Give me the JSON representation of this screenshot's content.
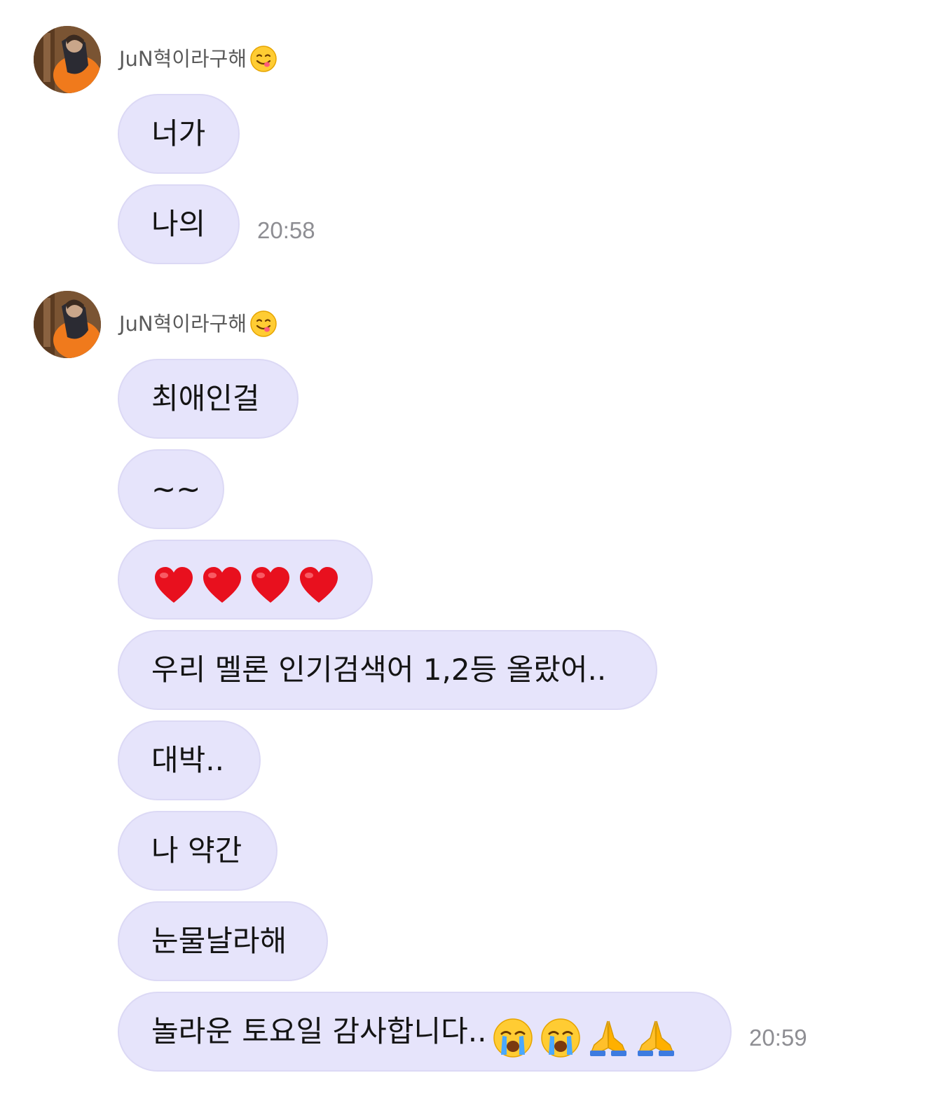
{
  "groups": [
    {
      "sender": {
        "name": "JuN혁이라구해",
        "emoji": "yum-face-emoji"
      },
      "messages": [
        "너가",
        "나의"
      ],
      "time": "20:58"
    },
    {
      "sender": {
        "name": "JuN혁이라구해",
        "emoji": "yum-face-emoji"
      },
      "messages": [
        "최애인걸",
        "~~",
        "",
        "우리 멜론 인기검색어 1,2등 올랐어..",
        "대박..",
        "나 약간",
        "눈물날라해",
        "놀라운 토요일 감사합니다.."
      ],
      "hearts_message": {
        "emoji": "red-heart-emoji",
        "count": 4
      },
      "last_message_emojis": [
        "crying-face-emoji",
        "crying-face-emoji",
        "folded-hands-emoji",
        "folded-hands-emoji"
      ],
      "time": "20:59"
    }
  ],
  "colors": {
    "bubble": "#e6e4fb",
    "bubble_border": "#dcd9f5",
    "time": "#8e8e93",
    "sender": "#5a5a5a"
  }
}
